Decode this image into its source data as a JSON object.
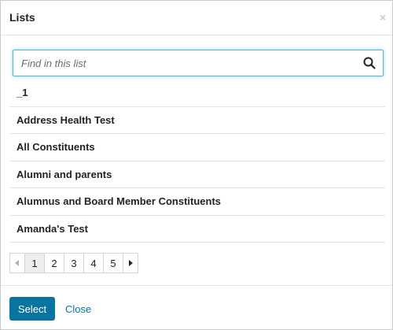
{
  "header": {
    "title": "Lists",
    "close_glyph": "×"
  },
  "search": {
    "placeholder": "Find in this list",
    "value": "",
    "icon": "search-icon"
  },
  "items": [
    {
      "label": "_1"
    },
    {
      "label": "Address Health Test"
    },
    {
      "label": "All Constituents"
    },
    {
      "label": "Alumni and parents"
    },
    {
      "label": "Alumnus and Board Member Constituents"
    },
    {
      "label": "Amanda's Test"
    }
  ],
  "pagination": {
    "current": 1,
    "pages": [
      "1",
      "2",
      "3",
      "4",
      "5"
    ],
    "prev_icon": "caret-left-icon",
    "next_icon": "caret-right-icon"
  },
  "footer": {
    "select_label": "Select",
    "close_label": "Close"
  },
  "colors": {
    "primary": "#0974a1",
    "focus_border": "#58b7d4",
    "divider": "#e2e3e4",
    "text": "#212327"
  }
}
